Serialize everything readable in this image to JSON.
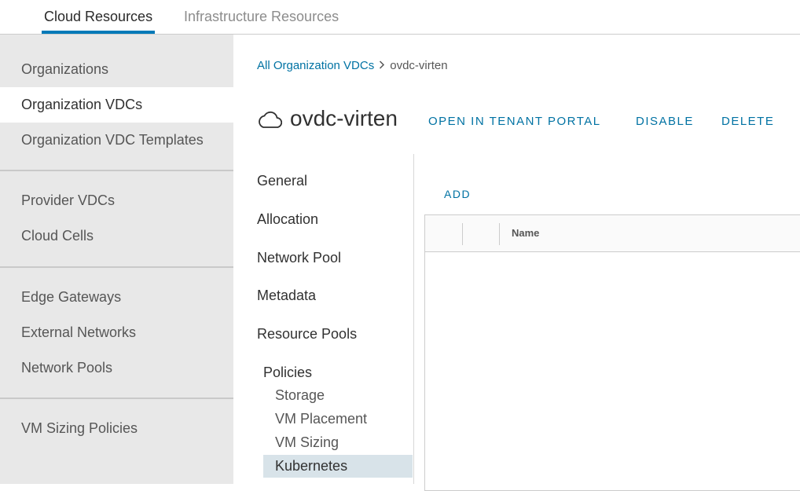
{
  "top_tabs": [
    {
      "label": "Cloud Resources",
      "active": true
    },
    {
      "label": "Infrastructure Resources",
      "active": false
    }
  ],
  "sidebar": {
    "groups": [
      {
        "items": [
          "Organizations",
          "Organization VDCs",
          "Organization VDC Templates"
        ]
      },
      {
        "items": [
          "Provider VDCs",
          "Cloud Cells"
        ]
      },
      {
        "items": [
          "Edge Gateways",
          "External Networks",
          "Network Pools"
        ]
      },
      {
        "items": [
          "VM Sizing Policies"
        ]
      }
    ],
    "active_item": "Organization VDCs"
  },
  "breadcrumb": {
    "parent": "All Organization VDCs",
    "separator": ">",
    "current": "ovdc-virten"
  },
  "header": {
    "icon": "cloud-icon",
    "title": "ovdc-virten",
    "actions": [
      "OPEN IN TENANT PORTAL",
      "DISABLE",
      "DELETE"
    ]
  },
  "subnav": {
    "items": [
      "General",
      "Allocation",
      "Network Pool",
      "Metadata",
      "Resource Pools"
    ],
    "group_label": "Policies",
    "group_children": [
      "Storage",
      "VM Placement",
      "VM Sizing",
      "Kubernetes"
    ],
    "active_child": "Kubernetes"
  },
  "grid": {
    "add_label": "ADD",
    "columns": [
      "Name"
    ]
  },
  "colors": {
    "accent": "#0079b8",
    "link": "#0072a3",
    "nav_bg": "#e8e8e8",
    "active_sub_bg": "#d8e3e9"
  }
}
